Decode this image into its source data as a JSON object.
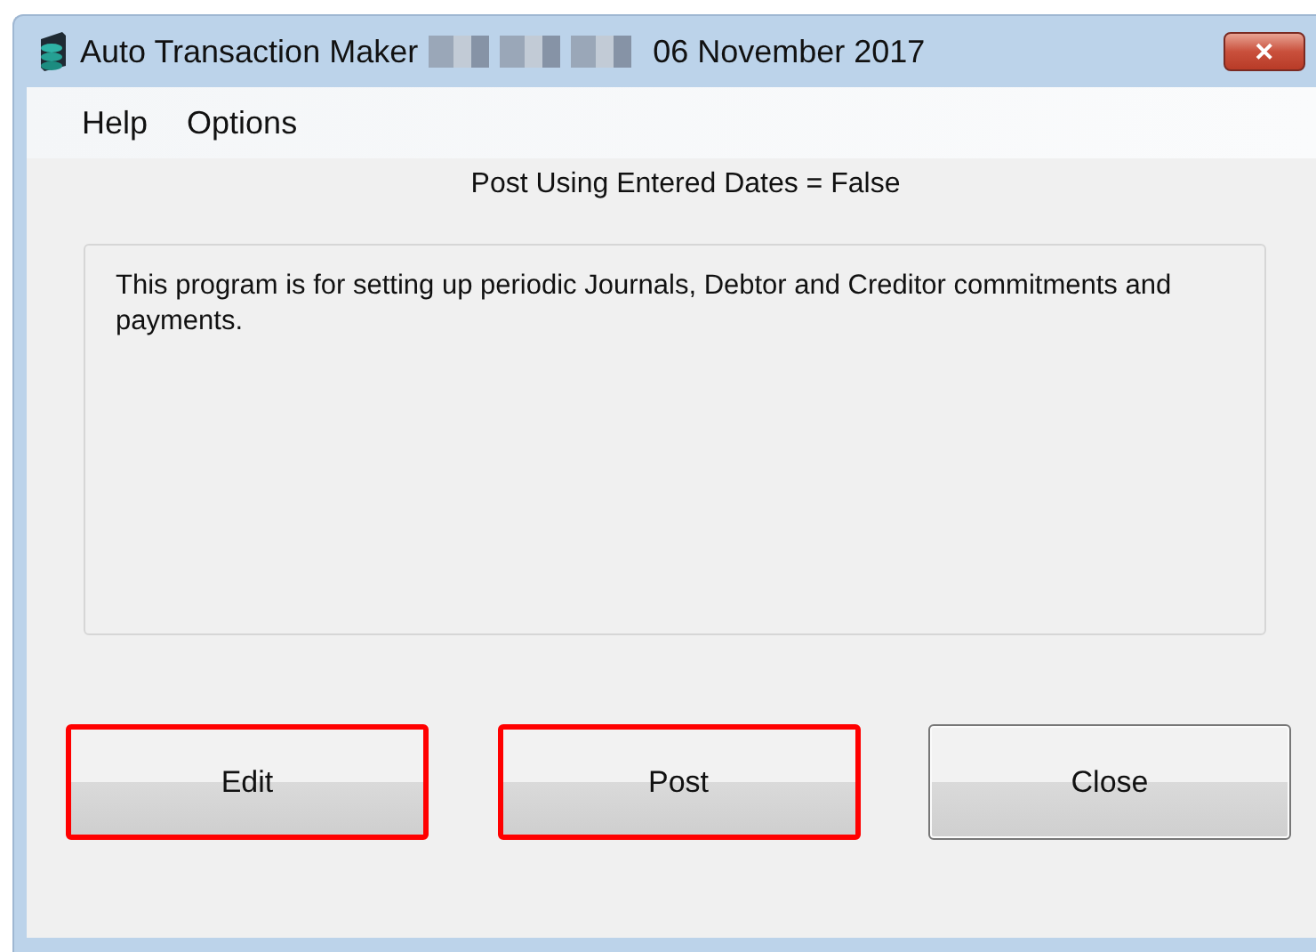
{
  "window": {
    "title_start": "Auto Transaction Maker",
    "title_end": "06 November 2017",
    "redacted": true,
    "close_label": "✕"
  },
  "menu": [
    {
      "label": "Help"
    },
    {
      "label": "Options"
    }
  ],
  "status": "Post Using Entered Dates = False",
  "description": "This program is for setting up periodic Journals, Debtor and Creditor commitments and payments.",
  "buttons": [
    {
      "label": "Edit",
      "highlighted": true
    },
    {
      "label": "Post",
      "highlighted": true
    },
    {
      "label": "Close",
      "highlighted": false
    }
  ]
}
